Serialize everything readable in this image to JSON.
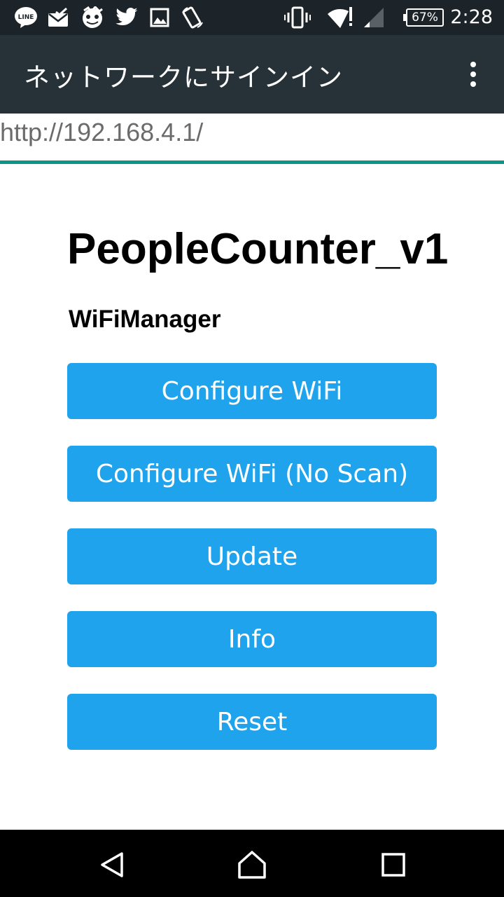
{
  "status_bar": {
    "time": "2:28",
    "battery": "67%",
    "notification_icons": [
      "line-icon",
      "mail-check-icon",
      "game-icon",
      "twitter-icon",
      "image-icon",
      "rotate-icon"
    ],
    "system_icons": [
      "vibrate-icon",
      "wifi-icon",
      "signal-icon",
      "battery-icon"
    ]
  },
  "app_bar": {
    "title": "ネットワークにサインイン",
    "menu_icon": "more-vertical-icon"
  },
  "url_bar": {
    "url": "http://192.168.4.1/",
    "accent_color": "#0f9488"
  },
  "page": {
    "title": "PeopleCounter_v1",
    "subtitle": "WiFiManager",
    "buttons": [
      {
        "label": "Configure WiFi"
      },
      {
        "label": "Configure WiFi (No Scan)"
      },
      {
        "label": "Update"
      },
      {
        "label": "Info"
      },
      {
        "label": "Reset"
      }
    ],
    "button_color": "#1fa3ec"
  },
  "nav_bar": {
    "buttons": [
      "back-icon",
      "home-icon",
      "recents-icon"
    ]
  }
}
